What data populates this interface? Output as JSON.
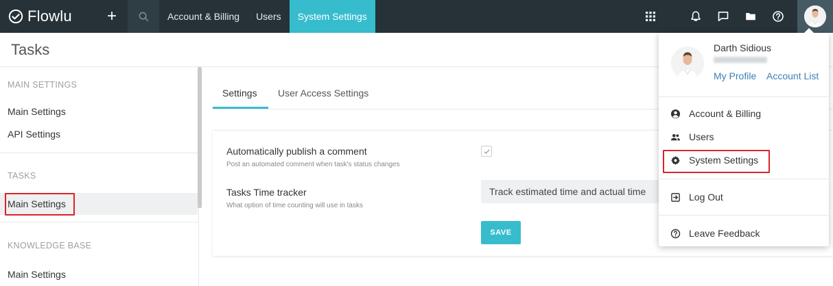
{
  "app": {
    "logo_text": "Flowlu",
    "add_icon": "plus-icon",
    "search_icon": "search-icon"
  },
  "nav": {
    "tabs": [
      {
        "label": "Account & Billing",
        "active": false
      },
      {
        "label": "Users",
        "active": false
      },
      {
        "label": "System Settings",
        "active": true
      }
    ]
  },
  "topbar_icons": [
    "apps-grid-icon",
    "bell-icon",
    "chat-icon",
    "folder-icon",
    "help-icon",
    "avatar"
  ],
  "page": {
    "title": "Tasks"
  },
  "sidebar": {
    "sections": [
      {
        "heading": "MAIN SETTINGS",
        "items": [
          "Main Settings",
          "API Settings"
        ]
      },
      {
        "heading": "TASKS",
        "items": [
          "Main Settings"
        ]
      },
      {
        "heading": "KNOWLEDGE BASE",
        "items": [
          "Main Settings"
        ]
      }
    ],
    "active_item": "TASKS / Main Settings"
  },
  "main": {
    "tabs": [
      {
        "label": "Settings",
        "active": true
      },
      {
        "label": "User Access Settings",
        "active": false
      }
    ],
    "fields": [
      {
        "label": "Automatically publish a comment",
        "hint": "Post an automated comment when task's status changes",
        "checked": true
      },
      {
        "label": "Tasks Time tracker",
        "hint": "What option of time counting will use in tasks",
        "value": "Track estimated time and actual time"
      }
    ],
    "save_label": "SAVE"
  },
  "user_menu": {
    "name": "Darth Sidious",
    "my_profile": "My Profile",
    "account_list": "Account List",
    "items": [
      {
        "label": "Account & Billing",
        "icon": "account-circle-icon"
      },
      {
        "label": "Users",
        "icon": "users-icon"
      },
      {
        "label": "System Settings",
        "icon": "gear-icon"
      },
      {
        "label": "Log Out",
        "icon": "logout-icon"
      },
      {
        "label": "Leave Feedback",
        "icon": "help-icon"
      }
    ]
  },
  "colors": {
    "topbar": "#263238",
    "accent": "#37bccd",
    "highlight": "#d9232a",
    "link": "#3d7fb3"
  }
}
